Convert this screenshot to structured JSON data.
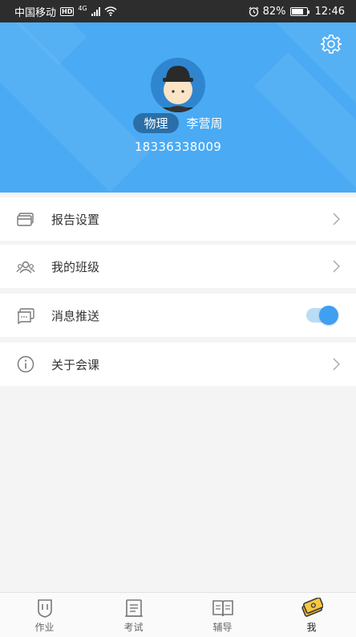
{
  "status_bar": {
    "carrier": "中国移动",
    "network_badge": "HD",
    "network_type": "4G",
    "battery": "82%",
    "time": "12:46"
  },
  "profile": {
    "subject": "物理",
    "name": "李营周",
    "phone": "18336338009"
  },
  "menu": {
    "items": [
      {
        "label": "报告设置",
        "icon": "card-icon"
      },
      {
        "label": "我的班级",
        "icon": "group-icon"
      },
      {
        "label": "消息推送",
        "icon": "message-icon",
        "toggle_on": true
      },
      {
        "label": "关于会课",
        "icon": "info-icon"
      }
    ]
  },
  "tabs": [
    {
      "label": "作业",
      "icon": "homework-icon"
    },
    {
      "label": "考试",
      "icon": "exam-icon"
    },
    {
      "label": "辅导",
      "icon": "book-icon"
    },
    {
      "label": "我",
      "icon": "me-icon",
      "active": true
    }
  ],
  "colors": {
    "header": "#4aaaf4",
    "accent": "#3f9ff0",
    "status_bar": "#2d2d2d"
  }
}
